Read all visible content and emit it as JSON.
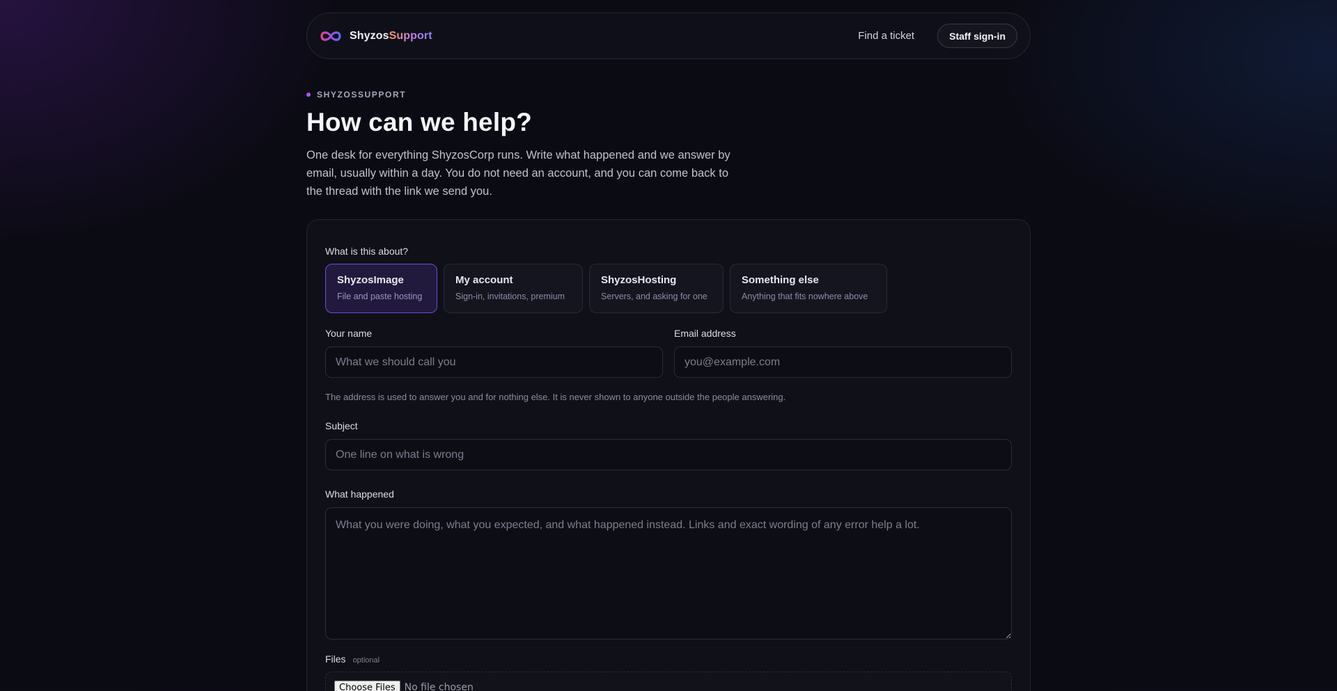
{
  "brand": {
    "name_part1": "Shyzos",
    "name_part2": "Support",
    "logo_icon": "infinity-icon"
  },
  "nav": {
    "find_ticket": "Find a ticket",
    "staff_signin": "Staff sign-in"
  },
  "hero": {
    "eyebrow": "SHYZOSSUPPORT",
    "title": "How can we help?",
    "description": "One desk for everything ShyzosCorp runs. Write what happened and we answer by email, usually within a day. You do not need an account, and you can come back to the thread with the link we send you."
  },
  "form": {
    "topic_label": "What is this about?",
    "topics": [
      {
        "title": "ShyzosImage",
        "subtitle": "File and paste hosting",
        "selected": true
      },
      {
        "title": "My account",
        "subtitle": "Sign-in, invitations, premium",
        "selected": false
      },
      {
        "title": "ShyzosHosting",
        "subtitle": "Servers, and asking for one",
        "selected": false
      },
      {
        "title": "Something else",
        "subtitle": "Anything that fits nowhere above",
        "selected": false
      }
    ],
    "name_label": "Your name",
    "name_placeholder": "What we should call you",
    "email_label": "Email address",
    "email_placeholder": "you@example.com",
    "email_hint": "The address is used to answer you and for nothing else. It is never shown to anyone outside the people answering.",
    "subject_label": "Subject",
    "subject_placeholder": "One line on what is wrong",
    "body_label": "What happened",
    "body_placeholder": "What you were doing, what you expected, and what happened instead. Links and exact wording of any error help a lot.",
    "files_label": "Files",
    "files_optional": "optional",
    "choose_files": "Choose Files",
    "no_file": "No file chosen"
  },
  "colors": {
    "accent": "#a855f7",
    "selected_border": "#6d4bd8",
    "background": "#0b0b14"
  }
}
